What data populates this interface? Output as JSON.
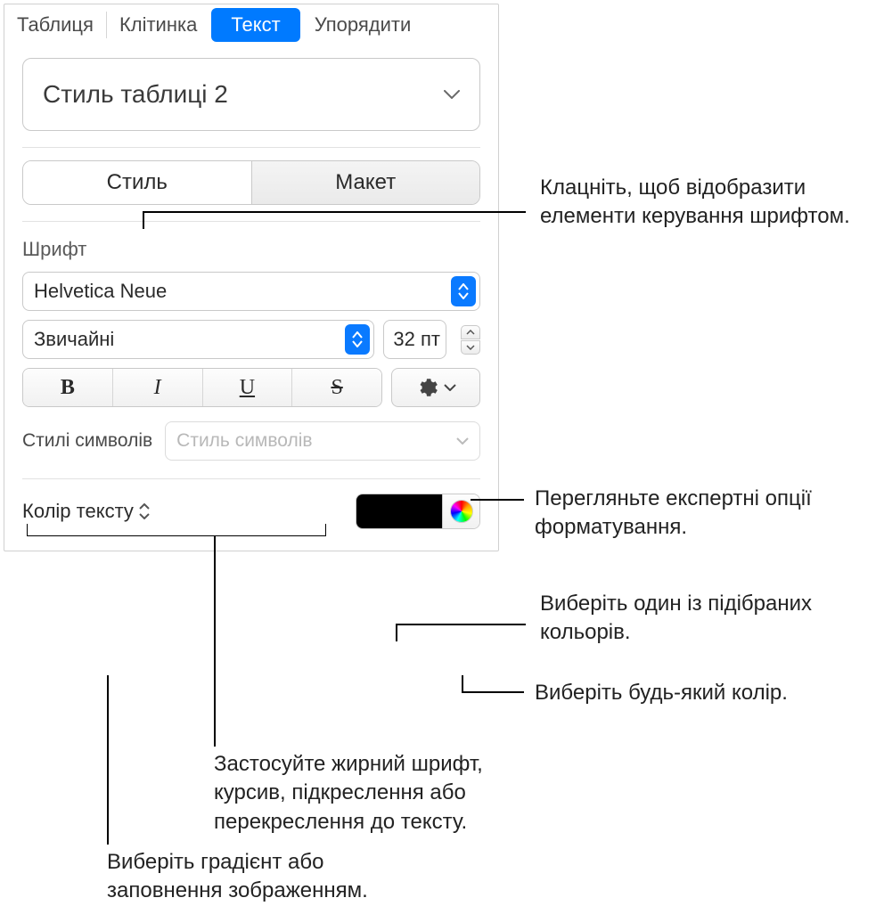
{
  "tabs": {
    "table": "Таблиця",
    "cell": "Клітинка",
    "text": "Текст",
    "arrange": "Упорядити"
  },
  "style_dropdown": "Стиль таблиці 2",
  "segmented": {
    "style": "Стиль",
    "layout": "Макет"
  },
  "font_section_label": "Шрифт",
  "font_family": "Helvetica Neue",
  "font_weight": "Звичайні",
  "font_size": "32 пт",
  "char_styles_label": "Стилі символів",
  "char_styles_placeholder": "Стиль символів",
  "text_color_label": "Колір тексту",
  "callouts": {
    "style_tab": "Клацніть, щоб відобразити елементи керування шрифтом.",
    "gear": "Перегляньте експертні опції форматування.",
    "swatch": "Виберіть один із підібраних кольорів.",
    "wheel": "Виберіть будь-який колір.",
    "bius": "Застосуйте жирний шрифт, курсив, підкреслення або перекреслення до тексту.",
    "text_color": "Виберіть градієнт або заповнення зображенням."
  }
}
